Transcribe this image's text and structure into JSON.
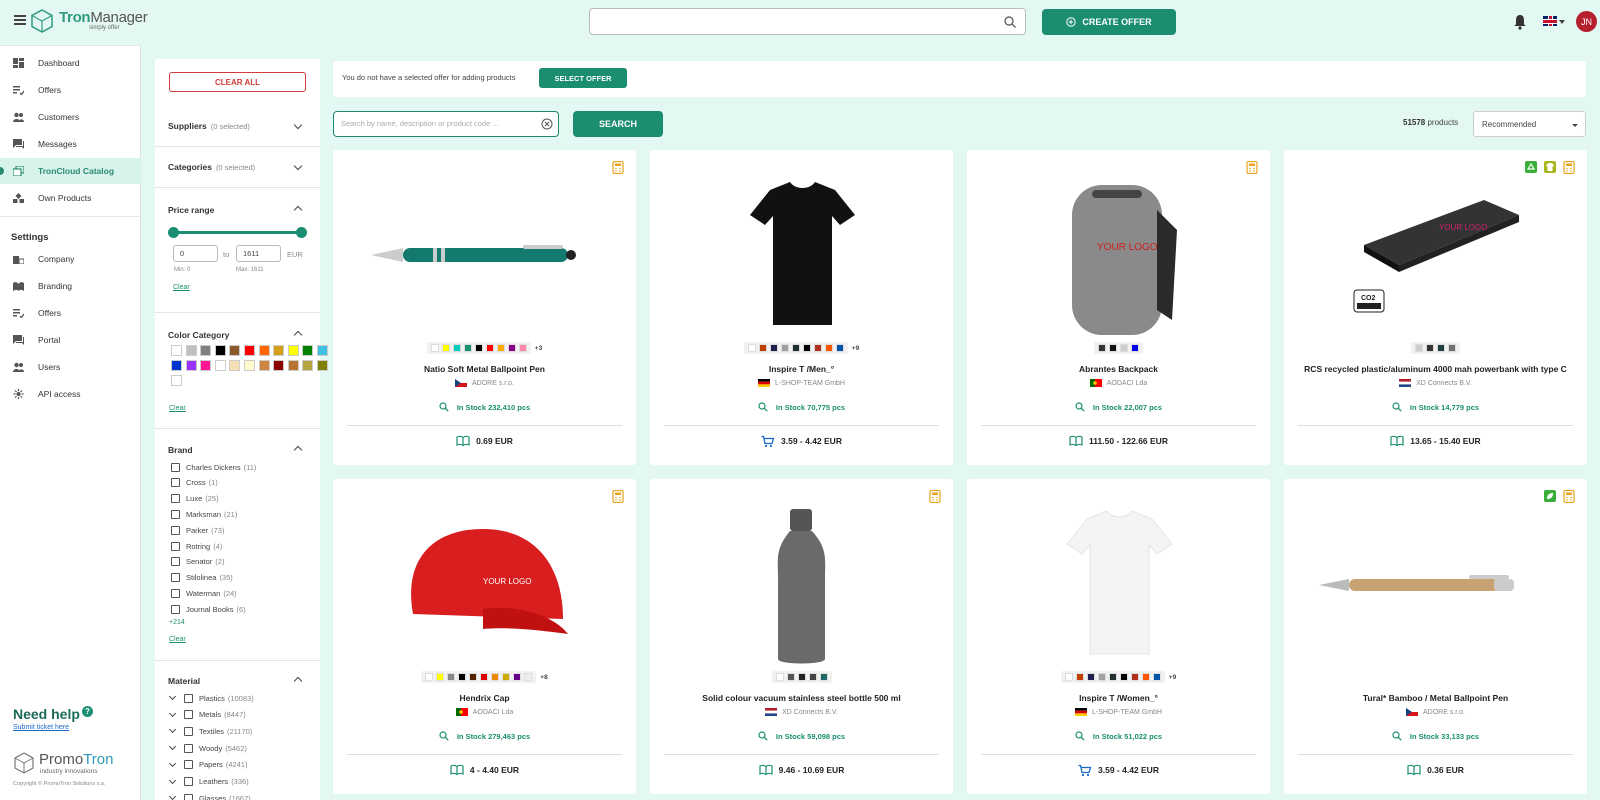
{
  "brand": {
    "name_a": "Tron",
    "name_b": "Manager",
    "tagline": "simply offer"
  },
  "topbar": {
    "search_placeholder": "",
    "create_offer_label": "CREATE OFFER",
    "avatar_initials": "JN"
  },
  "sidebar": {
    "items": [
      {
        "label": "Dashboard",
        "icon": "dashboard-icon"
      },
      {
        "label": "Offers",
        "icon": "offers-icon"
      },
      {
        "label": "Customers",
        "icon": "customers-icon"
      },
      {
        "label": "Messages",
        "icon": "messages-icon"
      },
      {
        "label": "TronCloud Catalog",
        "icon": "catalog-icon",
        "active": true
      },
      {
        "label": "Own Products",
        "icon": "own-products-icon"
      }
    ],
    "settings_heading": "Settings",
    "settings_items": [
      {
        "label": "Company",
        "icon": "company-icon"
      },
      {
        "label": "Branding",
        "icon": "branding-icon"
      },
      {
        "label": "Offers",
        "icon": "offers-icon"
      },
      {
        "label": "Portal",
        "icon": "portal-icon"
      },
      {
        "label": "Users",
        "icon": "users-icon"
      },
      {
        "label": "API access",
        "icon": "api-icon"
      }
    ],
    "need_help": "Need help",
    "submit_ticket": "Submit ticket here",
    "promo_name_a": "Promo",
    "promo_name_b": "Tron",
    "promo_sub": "industry innovations",
    "copyright": "Copyright © PromoTron Solutions s.a."
  },
  "filters": {
    "clear_all": "CLEAR ALL",
    "suppliers": {
      "label": "Suppliers",
      "selected": "(0 selected)"
    },
    "categories": {
      "label": "Categories",
      "selected": "(0 selected)"
    },
    "price_range": {
      "label": "Price range",
      "min": "0",
      "max": "1611",
      "to": "to",
      "currency": "EUR",
      "min_label": "Min: 0",
      "max_label": "Max: 1611",
      "clear": "Clear"
    },
    "color_category": {
      "label": "Color Category",
      "clear": "Clear",
      "swatches": [
        "#ffffff",
        "#c0c0c0",
        "#808080",
        "#000000",
        "#8b5a2b",
        "#ff0000",
        "#ff6600",
        "#d4a017",
        "#ffff00",
        "#008000",
        "#40c0e0",
        "#0033cc",
        "#9933ff",
        "#ff1493",
        "#ffffff",
        "#f5deb3",
        "#fffacd",
        "#cd853f",
        "#8b0000",
        "#b87333",
        "#b5a642",
        "#808000",
        "#ffffff"
      ]
    },
    "brand": {
      "label": "Brand",
      "more": "+214",
      "clear": "Clear",
      "items": [
        {
          "name": "Charles Dickens",
          "count": "(11)"
        },
        {
          "name": "Cross",
          "count": "(1)"
        },
        {
          "name": "Luxe",
          "count": "(25)"
        },
        {
          "name": "Marksman",
          "count": "(21)"
        },
        {
          "name": "Parker",
          "count": "(73)"
        },
        {
          "name": "Rotring",
          "count": "(4)"
        },
        {
          "name": "Senator",
          "count": "(2)"
        },
        {
          "name": "Stilolinea",
          "count": "(35)"
        },
        {
          "name": "Waterman",
          "count": "(24)"
        },
        {
          "name": "Journal Books",
          "count": "(6)"
        }
      ]
    },
    "material": {
      "label": "Material",
      "items": [
        {
          "name": "Plastics",
          "count": "(10083)"
        },
        {
          "name": "Metals",
          "count": "(8447)"
        },
        {
          "name": "Textiles",
          "count": "(21170)"
        },
        {
          "name": "Woody",
          "count": "(5462)"
        },
        {
          "name": "Papers",
          "count": "(4241)"
        },
        {
          "name": "Leathers",
          "count": "(336)"
        },
        {
          "name": "Glasses",
          "count": "(1667)"
        }
      ]
    }
  },
  "notice": {
    "text": "You do not have a selected offer for adding products",
    "button": "SELECT OFFER"
  },
  "search": {
    "placeholder": "Search by name, description or product code ...",
    "button": "SEARCH"
  },
  "results": {
    "count": "51578",
    "count_suffix": "products",
    "sort": "Recommended"
  },
  "products": [
    {
      "name": "Natio Soft Metal Ballpoint Pen",
      "supplier": "ADORE s.r.o.",
      "flag": "cz",
      "stock": "In Stock 232,410 pcs",
      "price": "0.69 EUR",
      "price_icon": "catalog-book-icon",
      "more": "+3",
      "colors": [
        "#ffffff",
        "#ffff00",
        "#00ccbb",
        "#1b8e72",
        "#000000",
        "#ff0000",
        "#ffaa00",
        "#880088",
        "#ff88aa"
      ],
      "badges": [
        "calculator-icon"
      ]
    },
    {
      "name": "Inspire T /Men_°",
      "supplier": "L-SHOP-TEAM GmbH",
      "flag": "de",
      "stock": "In Stock 70,775 pcs",
      "price": "3.59 - 4.42 EUR",
      "price_icon": "cart-icon",
      "more": "+9",
      "colors": [
        "#ffffff",
        "#c04000",
        "#202050",
        "#a0a0a0",
        "#203030",
        "#000000",
        "#b03020",
        "#ff5500",
        "#0055aa"
      ],
      "badges": []
    },
    {
      "name": "Abrantes Backpack",
      "supplier": "AODACI Lda",
      "flag": "pt",
      "stock": "In Stock 22,007 pcs",
      "price": "111.50 - 122.66 EUR",
      "price_icon": "catalog-book-icon",
      "more": "",
      "colors": [
        "#333333",
        "#111111",
        "#cccccc",
        "#0000ee"
      ],
      "badges": [
        "calculator-icon"
      ]
    },
    {
      "name": "RCS recycled plastic/aluminum 4000 mah powerbank with type C",
      "supplier": "XD Connects B.V.",
      "flag": "nl",
      "stock": "In Stock 14,779 pcs",
      "price": "13.65 - 15.40 EUR",
      "price_icon": "catalog-book-icon",
      "more": "",
      "colors": [
        "#cccccc",
        "#333333",
        "#204040",
        "#707070"
      ],
      "badges": [
        "recycle-icon",
        "shirt-icon",
        "calculator-icon"
      ]
    },
    {
      "name": "Hendrix Cap",
      "supplier": "AODACI Lda",
      "flag": "pt",
      "stock": "In Stock 279,463 pcs",
      "price": "4 - 4.40 EUR",
      "price_icon": "catalog-book-icon",
      "more": "+8",
      "colors": [
        "#ffffff",
        "#ffff00",
        "#888888",
        "#000000",
        "#552200",
        "#dd0000",
        "#ee8800",
        "#ccaa00",
        "#660088",
        "#eeeeee"
      ],
      "badges": [
        "calculator-icon"
      ]
    },
    {
      "name": "Solid colour vacuum stainless steel bottle 500 ml",
      "supplier": "XD Connects B.V.",
      "flag": "nl",
      "stock": "In Stock 59,098 pcs",
      "price": "9.46 - 10.69 EUR",
      "price_icon": "catalog-book-icon",
      "more": "",
      "colors": [
        "#ffffff",
        "#555555",
        "#222222",
        "#444444",
        "#226666"
      ],
      "badges": [
        "calculator-icon"
      ]
    },
    {
      "name": "Inspire T /Women_°",
      "supplier": "L-SHOP-TEAM GmbH",
      "flag": "de",
      "stock": "In Stock 51,022 pcs",
      "price": "3.59 - 4.42 EUR",
      "price_icon": "cart-icon",
      "more": "+9",
      "colors": [
        "#ffffff",
        "#c04000",
        "#202050",
        "#a0a0a0",
        "#203030",
        "#000000",
        "#b03020",
        "#ff5500",
        "#0055aa"
      ],
      "badges": []
    },
    {
      "name": "Tural* Bamboo / Metal Ballpoint Pen",
      "supplier": "ADORE s.r.o.",
      "flag": "cz",
      "stock": "In Stock 33,133 pcs",
      "price": "0.36 EUR",
      "price_icon": "catalog-book-icon",
      "more": "",
      "colors": [],
      "badges": [
        "leaf-icon",
        "calculator-icon"
      ]
    }
  ],
  "accent": "#1b8e72"
}
